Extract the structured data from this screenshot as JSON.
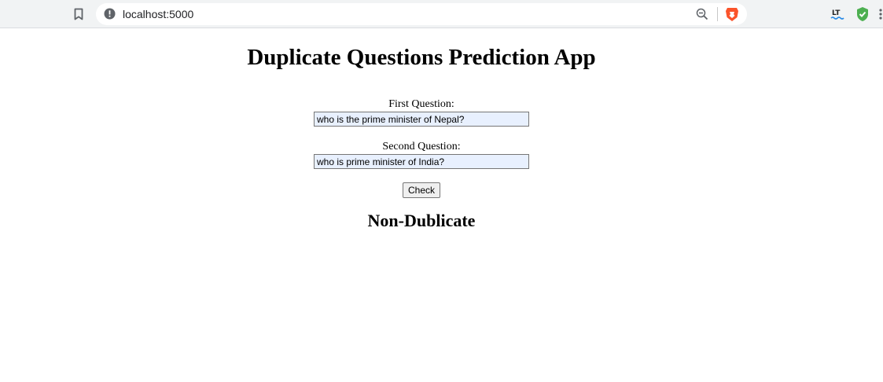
{
  "browser": {
    "url": "localhost:5000"
  },
  "page": {
    "title": "Duplicate Questions Prediction App",
    "first_question": {
      "label": "First Question:",
      "value": "who is the prime minister of Nepal?"
    },
    "second_question": {
      "label": "Second Question:",
      "value": "who is prime minister of India?"
    },
    "check_button": "Check",
    "result": "Non-Dublicate"
  },
  "icons": [
    "bookmark-icon",
    "site-info-icon",
    "zoom-icon",
    "brave-shields-icon",
    "languagetool-extension-icon",
    "shield-extension-icon",
    "menu-icon"
  ],
  "colors": {
    "toolbar_bg": "#f1f3f4",
    "input_autofill_bg": "#e8f0fe",
    "brave_orange": "#fb542b",
    "shield_green": "#4caf50"
  }
}
